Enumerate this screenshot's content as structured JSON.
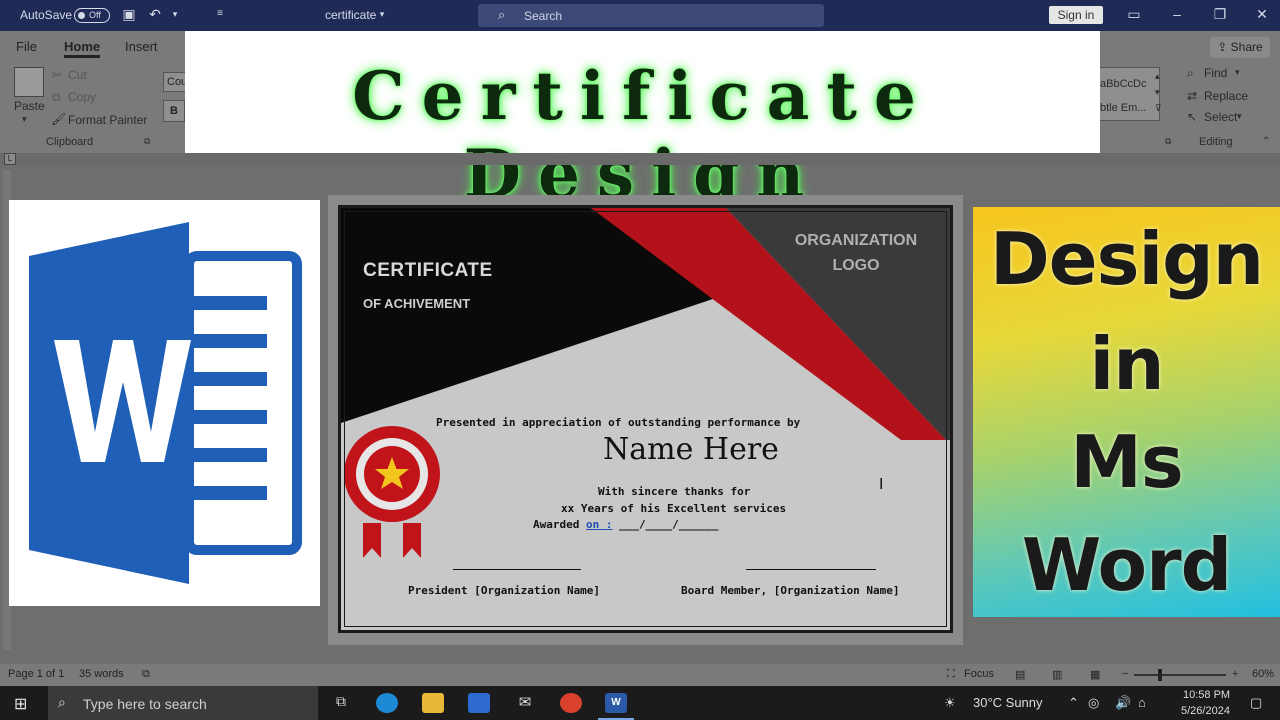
{
  "titlebar": {
    "autosave_label": "AutoSave",
    "autosave_state": "Off",
    "doc_title": "certificate",
    "search_placeholder": "Search",
    "signin_label": "Sign in"
  },
  "ribbon": {
    "tabs": [
      "File",
      "Home",
      "Insert"
    ],
    "share_label": "Share",
    "clipboard": {
      "paste": "Paste",
      "cut": "Cut",
      "copy": "Copy",
      "format_painter": "Format Painter",
      "group_label": "Clipboard"
    },
    "font_box_text": "Cou",
    "bold_label": "B",
    "styles": {
      "style1": "aBbCcDc",
      "style2": "btle Em..."
    },
    "editing": {
      "find": "Find",
      "replace": "Replace",
      "select": "Select",
      "group_label": "Editing"
    }
  },
  "banner": {
    "title": "Certificate Design"
  },
  "certificate": {
    "title": "CERTIFICATE",
    "subtitle": "OF ACHIVEMENT",
    "org_logo_line1": "ORGANIZATION",
    "org_logo_line2": "LOGO",
    "presented": "Presented in appreciation of outstanding performance by",
    "name": "Name Here",
    "thanks": "With sincere thanks for",
    "years": "xx Years of his Excellent services",
    "awarded_prefix": "Awarded ",
    "awarded_on": "on :",
    "awarded_blank": " ___/____/______",
    "sign_left": "President [Organization Name]",
    "sign_right": "Board Member, [Organization Name]"
  },
  "design_card": {
    "line1": "Design",
    "line2": "in",
    "line3": "Ms",
    "line4": "Word"
  },
  "statusbar": {
    "page": "Page 1 of 1",
    "words": "35 words",
    "focus": "Focus",
    "zoom": "60%"
  },
  "taskbar": {
    "search_placeholder": "Type here to search",
    "weather": "30°C  Sunny",
    "time": "10:58 PM",
    "date": "5/26/2024"
  },
  "colors": {
    "titlebar": "#1f2a57",
    "cert_red": "#c0141a",
    "word_blue": "#1f5fb8",
    "glow_green": "#3df03d"
  }
}
